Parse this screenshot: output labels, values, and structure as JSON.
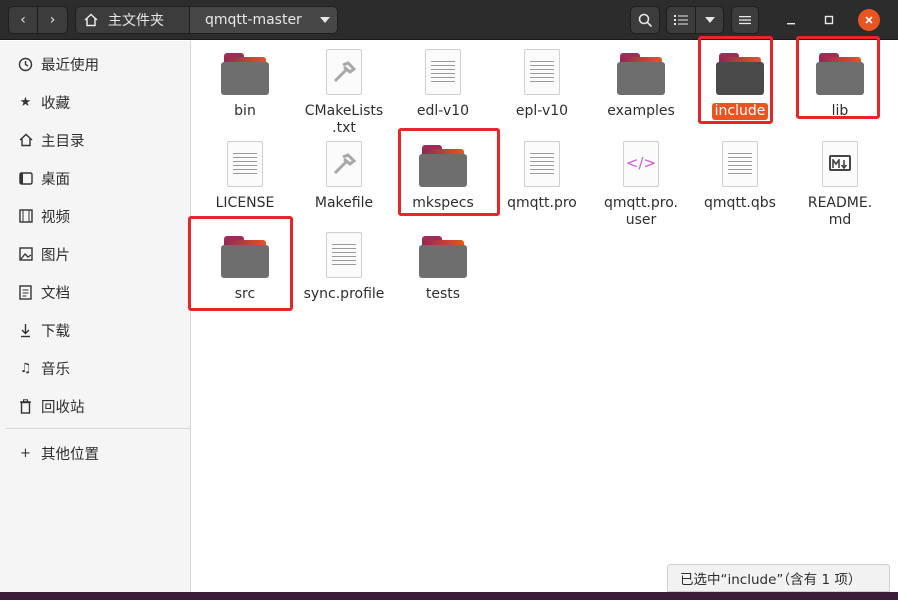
{
  "header": {
    "home_label": "主文件夹",
    "current_folder": "qmqtt-master"
  },
  "sidebar": {
    "items": [
      {
        "label": "最近使用",
        "icon": "clock-icon"
      },
      {
        "label": "收藏",
        "icon": "star-icon"
      },
      {
        "label": "主目录",
        "icon": "home-icon"
      },
      {
        "label": "桌面",
        "icon": "desktop-icon"
      },
      {
        "label": "视频",
        "icon": "video-icon"
      },
      {
        "label": "图片",
        "icon": "picture-icon"
      },
      {
        "label": "文档",
        "icon": "document-icon"
      },
      {
        "label": "下载",
        "icon": "download-icon"
      },
      {
        "label": "音乐",
        "icon": "music-icon"
      },
      {
        "label": "回收站",
        "icon": "trash-icon"
      }
    ],
    "other_locations": "其他位置"
  },
  "files": [
    {
      "name": "bin",
      "type": "folder"
    },
    {
      "name": "CMakeLists\n.txt",
      "type": "cmake"
    },
    {
      "name": "edl-v10",
      "type": "text"
    },
    {
      "name": "epl-v10",
      "type": "text"
    },
    {
      "name": "examples",
      "type": "folder"
    },
    {
      "name": "include",
      "type": "folder",
      "selected": true
    },
    {
      "name": "lib",
      "type": "folder"
    },
    {
      "name": "LICENSE",
      "type": "text"
    },
    {
      "name": "Makefile",
      "type": "cmake"
    },
    {
      "name": "mkspecs",
      "type": "folder"
    },
    {
      "name": "qmqtt.pro",
      "type": "text"
    },
    {
      "name": "qmqtt.pro.\nuser",
      "type": "code"
    },
    {
      "name": "qmqtt.qbs",
      "type": "text"
    },
    {
      "name": "README.\nmd",
      "type": "markdown"
    },
    {
      "name": "src",
      "type": "folder"
    },
    {
      "name": "sync.profile",
      "type": "text"
    },
    {
      "name": "tests",
      "type": "folder"
    }
  ],
  "status": "已选中“include”（含有 1 项）",
  "colors": {
    "accent": "#e95420",
    "highlight": "#e8262a"
  }
}
